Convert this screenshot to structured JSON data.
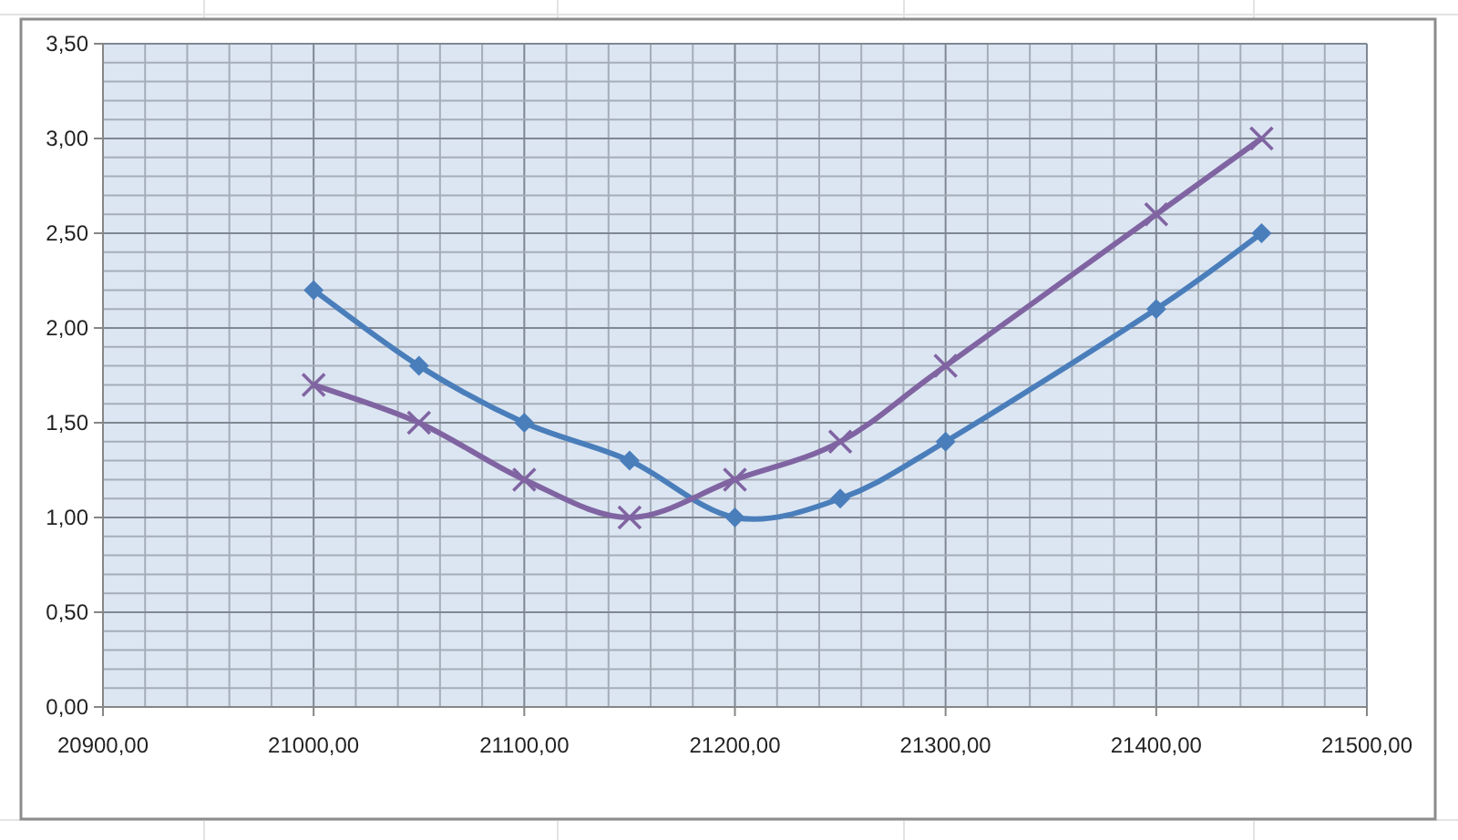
{
  "chart_data": {
    "type": "line",
    "grid": true,
    "x": [
      21000,
      21050,
      21100,
      21150,
      21200,
      21250,
      21300,
      21400,
      21450
    ],
    "series": [
      {
        "color": "#4a7ebb",
        "marker": "diamond",
        "values": [
          2.2,
          1.8,
          1.5,
          1.3,
          1.0,
          1.1,
          1.4,
          2.1,
          2.5
        ]
      },
      {
        "color": "#8064a2",
        "marker": "cross",
        "values": [
          1.7,
          1.5,
          1.2,
          1.0,
          1.2,
          1.4,
          1.8,
          2.6,
          3.0
        ]
      }
    ],
    "xlim": [
      20900,
      21500
    ],
    "ylim": [
      0,
      3.5
    ],
    "xticks": [
      {
        "value": 20900,
        "label": "20900,00"
      },
      {
        "value": 21000,
        "label": "21000,00"
      },
      {
        "value": 21100,
        "label": "21100,00"
      },
      {
        "value": 21200,
        "label": "21200,00"
      },
      {
        "value": 21300,
        "label": "21300,00"
      },
      {
        "value": 21400,
        "label": "21400,00"
      },
      {
        "value": 21500,
        "label": "21500,00"
      }
    ],
    "yticks": [
      {
        "value": 0,
        "label": "0,00"
      },
      {
        "value": 0.5,
        "label": "0,50"
      },
      {
        "value": 1,
        "label": "1,00"
      },
      {
        "value": 1.5,
        "label": "1,50"
      },
      {
        "value": 2,
        "label": "2,00"
      },
      {
        "value": 2.5,
        "label": "2,50"
      },
      {
        "value": 3,
        "label": "3,00"
      },
      {
        "value": 3.5,
        "label": "3,50"
      }
    ]
  }
}
